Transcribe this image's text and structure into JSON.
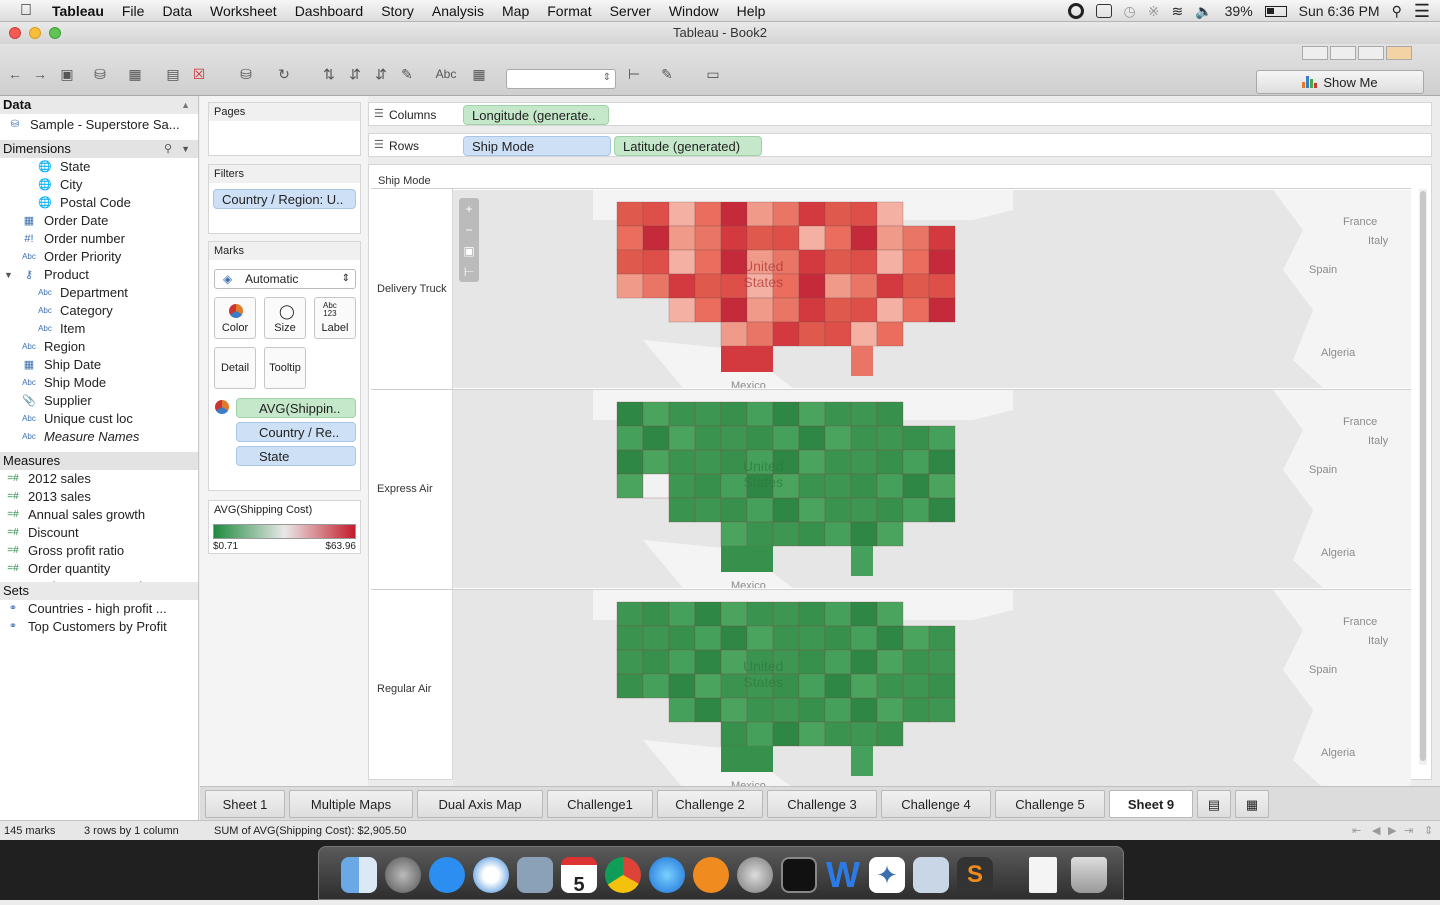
{
  "menubar": {
    "app": "Tableau",
    "items": [
      "File",
      "Data",
      "Worksheet",
      "Dashboard",
      "Story",
      "Analysis",
      "Map",
      "Format",
      "Server",
      "Window",
      "Help"
    ],
    "battery": "39%",
    "clock": "Sun 6:36 PM"
  },
  "window": {
    "title": "Tableau - Book2"
  },
  "toolbar": {
    "abc_label": "Abc",
    "show_me": "Show Me"
  },
  "data_pane": {
    "header": "Data",
    "datasource": "Sample - Superstore Sa...",
    "dimensions_header": "Dimensions",
    "dimensions": [
      {
        "label": "State",
        "icon": "globe-icon",
        "indent": 2
      },
      {
        "label": "City",
        "icon": "globe-icon",
        "indent": 2
      },
      {
        "label": "Postal Code",
        "icon": "globe-icon",
        "indent": 2
      },
      {
        "label": "Order Date",
        "icon": "calendar-icon",
        "indent": 1
      },
      {
        "label": "Order number",
        "icon": "number-icon",
        "indent": 1
      },
      {
        "label": "Order Priority",
        "icon": "abc-icon",
        "indent": 1
      },
      {
        "label": "Product",
        "icon": "hierarchy-icon",
        "indent": 1
      },
      {
        "label": "Department",
        "icon": "abc-icon",
        "indent": 2
      },
      {
        "label": "Category",
        "icon": "abc-icon",
        "indent": 2
      },
      {
        "label": "Item",
        "icon": "abc-icon",
        "indent": 2
      },
      {
        "label": "Region",
        "icon": "abc-icon",
        "indent": 1
      },
      {
        "label": "Ship Date",
        "icon": "calendar-icon",
        "indent": 1
      },
      {
        "label": "Ship Mode",
        "icon": "abc-icon",
        "indent": 1
      },
      {
        "label": "Supplier",
        "icon": "paperclip-icon",
        "indent": 1
      },
      {
        "label": "Unique cust loc",
        "icon": "abc-icon",
        "indent": 1
      },
      {
        "label": "Measure Names",
        "icon": "abc-icon",
        "indent": 1
      }
    ],
    "measures_header": "Measures",
    "measures": [
      "2012 sales",
      "2013 sales",
      "Annual sales growth",
      "Discount",
      "Gross profit ratio",
      "Order quantity",
      "Product Base Margin"
    ],
    "sets_header": "Sets",
    "sets": [
      "Countries - high profit ...",
      "Top Customers by Profit"
    ]
  },
  "shelves": {
    "pages": "Pages",
    "filters": "Filters",
    "filter_pill": "Country / Region: U..",
    "marks": "Marks",
    "mark_type": "Automatic",
    "color": "Color",
    "size": "Size",
    "label": "Label",
    "detail": "Detail",
    "tooltip": "Tooltip",
    "label_icon_text": "Abc\n123",
    "mark_pills": [
      "AVG(Shippin..",
      "Country / Re..",
      "State"
    ],
    "legend_title": "AVG(Shipping Cost)",
    "legend_min": "$0.71",
    "legend_max": "$63.96",
    "legend_colors": {
      "low": "#1e8a3e",
      "mid": "#e8e8e8",
      "high": "#c41c2c"
    }
  },
  "columns": {
    "label": "Columns",
    "pills": [
      "Longitude (generate.."
    ]
  },
  "rows": {
    "label": "Rows",
    "pills": [
      "Ship Mode",
      "Latitude (generated)"
    ]
  },
  "view": {
    "header": "Ship Mode",
    "panes": [
      {
        "label": "Delivery Truck",
        "country_label": "United\nStates",
        "tint": "red"
      },
      {
        "label": "Express Air",
        "country_label": "United\nStates",
        "tint": "green"
      },
      {
        "label": "Regular Air",
        "country_label": "United\nStates",
        "tint": "green"
      }
    ],
    "map_labels": {
      "france": "France",
      "italy": "Italy",
      "spain": "Spain",
      "algeria": "Algeria",
      "mexico": "Mexico"
    }
  },
  "tabs": [
    "Sheet 1",
    "Multiple Maps",
    "Dual Axis Map",
    "Challenge1",
    "Challenge 2",
    "Challenge 3",
    "Challenge 4",
    "Challenge 5",
    "Sheet 9"
  ],
  "active_tab": "Sheet 9",
  "status": {
    "marks": "145 marks",
    "dims": "3 rows by 1 column",
    "sum": "SUM of AVG(Shipping Cost): $2,905.50"
  },
  "dock": {
    "calendar_day": "5"
  }
}
